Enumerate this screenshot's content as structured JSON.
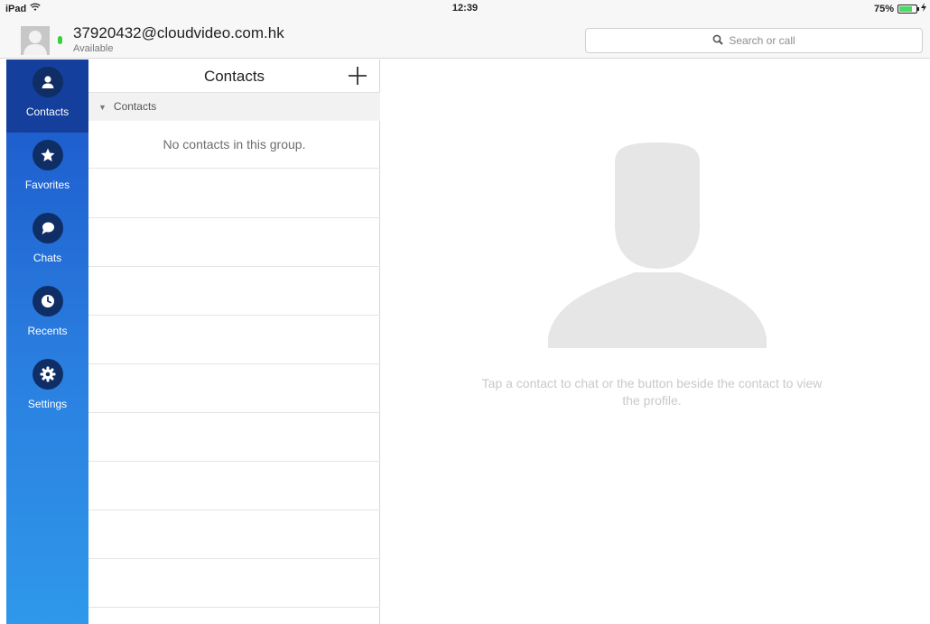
{
  "status_bar": {
    "device": "iPad",
    "time": "12:39",
    "battery": "75%",
    "battery_level": 0.75
  },
  "user": {
    "name": "37920432@cloudvideo.com.hk",
    "status": "Available"
  },
  "search": {
    "placeholder": "Search or call"
  },
  "nav": {
    "items": [
      {
        "label": "Contacts",
        "icon": "person-icon",
        "active": true
      },
      {
        "label": "Favorites",
        "icon": "star-icon",
        "active": false
      },
      {
        "label": "Chats",
        "icon": "chat-bubble-icon",
        "active": false
      },
      {
        "label": "Recents",
        "icon": "clock-icon",
        "active": false
      },
      {
        "label": "Settings",
        "icon": "gear-icon",
        "active": false
      }
    ]
  },
  "contacts_panel": {
    "title": "Contacts",
    "group_label": "Contacts",
    "empty_message": "No contacts in this group."
  },
  "detail": {
    "hint": "Tap a contact to chat or the button beside the contact to view the profile."
  },
  "colors": {
    "nav_top": "#1b55c9",
    "nav_bottom": "#2f98ea",
    "nav_active": "#143f9c",
    "presence": "#3ccf3c"
  }
}
